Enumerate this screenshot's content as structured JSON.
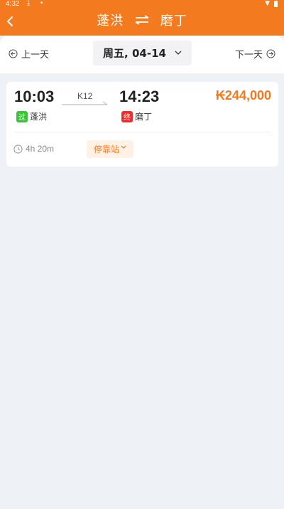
{
  "status_bar": {
    "time": "4:32"
  },
  "header": {
    "from": "蓬洪",
    "to": "磨丁",
    "back_icon": "chevron-left-icon",
    "swap_icon": "swap-arrows-icon",
    "bg_color": "#f47a20"
  },
  "date_nav": {
    "prev_label": "上一天",
    "next_label": "下一天",
    "current_date": "周五, 04-14"
  },
  "trains": [
    {
      "depart_time": "10:03",
      "arrive_time": "14:23",
      "train_number": "K12",
      "price": "₭244,000",
      "from_badge": "过",
      "from_station": "蓬洪",
      "to_badge": "终",
      "to_station": "磨丁",
      "duration": "4h 20m",
      "stops_label": "停靠站"
    }
  ],
  "colors": {
    "accent": "#f47a20",
    "pass_badge": "#3ec23c",
    "end_badge": "#ee2d2d",
    "background": "#eef1f6"
  }
}
